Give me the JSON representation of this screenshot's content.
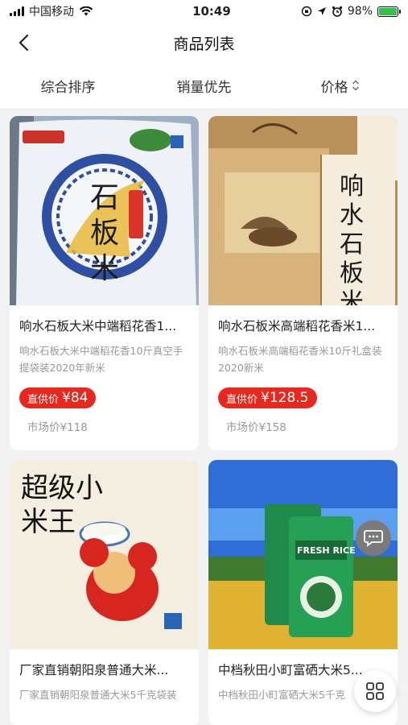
{
  "status_bar": {
    "carrier": "中国移动",
    "time": "10:49",
    "battery_percent": "98%",
    "battery_level": 0.98,
    "icons": [
      "signal-icon",
      "wifi-icon",
      "orientation-lock-icon",
      "location-icon",
      "alarm-icon",
      "battery-icon"
    ]
  },
  "nav": {
    "title": "商品列表",
    "back_icon": "chevron-left-icon"
  },
  "sort": {
    "items": [
      {
        "label": "综合排序"
      },
      {
        "label": "销量优先"
      },
      {
        "label": "价格",
        "icon": "sort-updown-icon"
      }
    ]
  },
  "products": [
    {
      "title": "响水石板大米中端稻花香1...",
      "desc": "响水石板大米中端稻花香10斤真空手提袋装2020年新米",
      "price_label": "直供价",
      "price": "¥84",
      "market": "市场价¥118",
      "image_text": "石板米"
    },
    {
      "title": "响水石板米高端稻花香米1...",
      "desc": "响水石板米高端稻花香米10斤礼盒装2020新米",
      "price_label": "直供价",
      "price": "¥128.5",
      "market": "市场价¥158",
      "image_text": "响水石板米"
    },
    {
      "title": "厂家直销朝阳泉普通大米...",
      "desc": "厂家直销朝阳泉普通大米5千克袋装",
      "image_text": "超级小米王"
    },
    {
      "title": "中档秋田小町富硒大米5...",
      "desc": "中档秋田小町富硒大米5千克",
      "image_text": "FRESH RICE"
    }
  ],
  "fabs": {
    "chat_icon": "chat-bubble-icon",
    "grid_icon": "grid-icon"
  },
  "colors": {
    "accent_red": "#e8281e",
    "battery_green": "#36c24a"
  }
}
